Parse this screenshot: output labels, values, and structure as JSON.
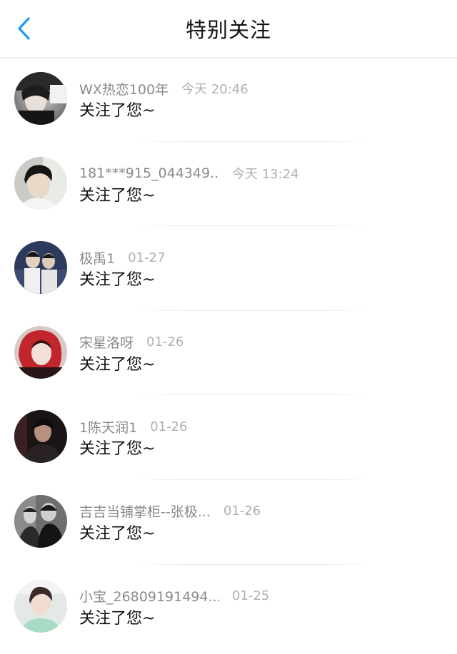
{
  "header": {
    "title": "特别关注",
    "back_icon": "chevron-left-icon",
    "accent_color": "#1a9cf0"
  },
  "items": [
    {
      "username": "WX热恋100年",
      "time": "今天 20:46",
      "message": "关注了您~",
      "avatar": "avatar-image"
    },
    {
      "username": "181***915_044349...",
      "time": "今天 13:24",
      "message": "关注了您~",
      "avatar": "avatar-image"
    },
    {
      "username": "极禹1",
      "time": "01-27",
      "message": "关注了您~",
      "avatar": "avatar-image"
    },
    {
      "username": "宋星洛呀",
      "time": "01-26",
      "message": "关注了您~",
      "avatar": "avatar-image"
    },
    {
      "username": "1陈天润1",
      "time": "01-26",
      "message": "关注了您~",
      "avatar": "avatar-image"
    },
    {
      "username": "吉吉当铺掌柜--张极...",
      "time": "01-26",
      "message": "关注了您~",
      "avatar": "avatar-image"
    },
    {
      "username": "小宝_26809191494...",
      "time": "01-25",
      "message": "关注了您~",
      "avatar": "avatar-image"
    }
  ]
}
